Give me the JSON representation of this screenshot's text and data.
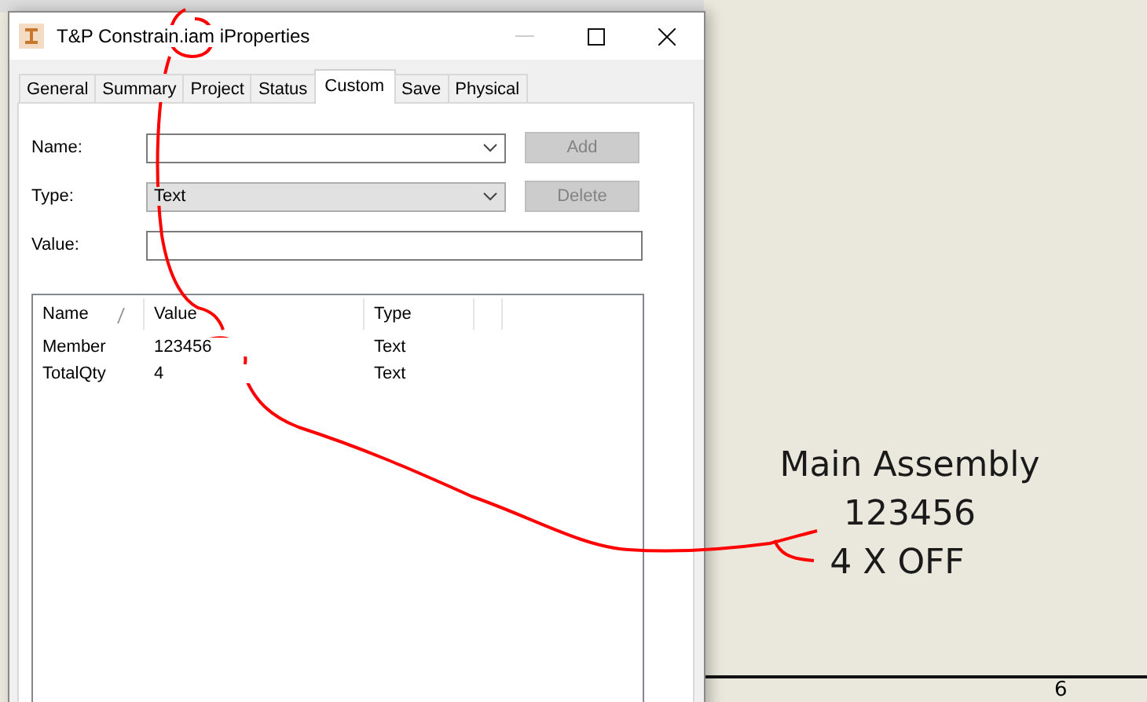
{
  "window": {
    "title": "T&P Constrain.iam iProperties"
  },
  "tabs": [
    {
      "label": "General",
      "selected": false
    },
    {
      "label": "Summary",
      "selected": false
    },
    {
      "label": "Project",
      "selected": false
    },
    {
      "label": "Status",
      "selected": false
    },
    {
      "label": "Custom",
      "selected": true
    },
    {
      "label": "Save",
      "selected": false
    },
    {
      "label": "Physical",
      "selected": false
    }
  ],
  "form": {
    "name": {
      "label": "Name:"
    },
    "type": {
      "label": "Type:",
      "value": "Text"
    },
    "value": {
      "label": "Value:"
    }
  },
  "buttons": [
    {
      "label": "Add",
      "disabled": true
    },
    {
      "label": "Delete",
      "disabled": true
    }
  ],
  "table": {
    "columns": [
      "Name",
      "Value",
      "Type"
    ],
    "rows": [
      {
        "name": "Member",
        "value": "123456",
        "type": "Text"
      },
      {
        "name": "TotalQty",
        "value": "4",
        "type": "Text"
      }
    ]
  },
  "drawing": {
    "labels": [
      "Main Assembly",
      "123456",
      "4 X OFF"
    ],
    "sheet_number": "6"
  }
}
